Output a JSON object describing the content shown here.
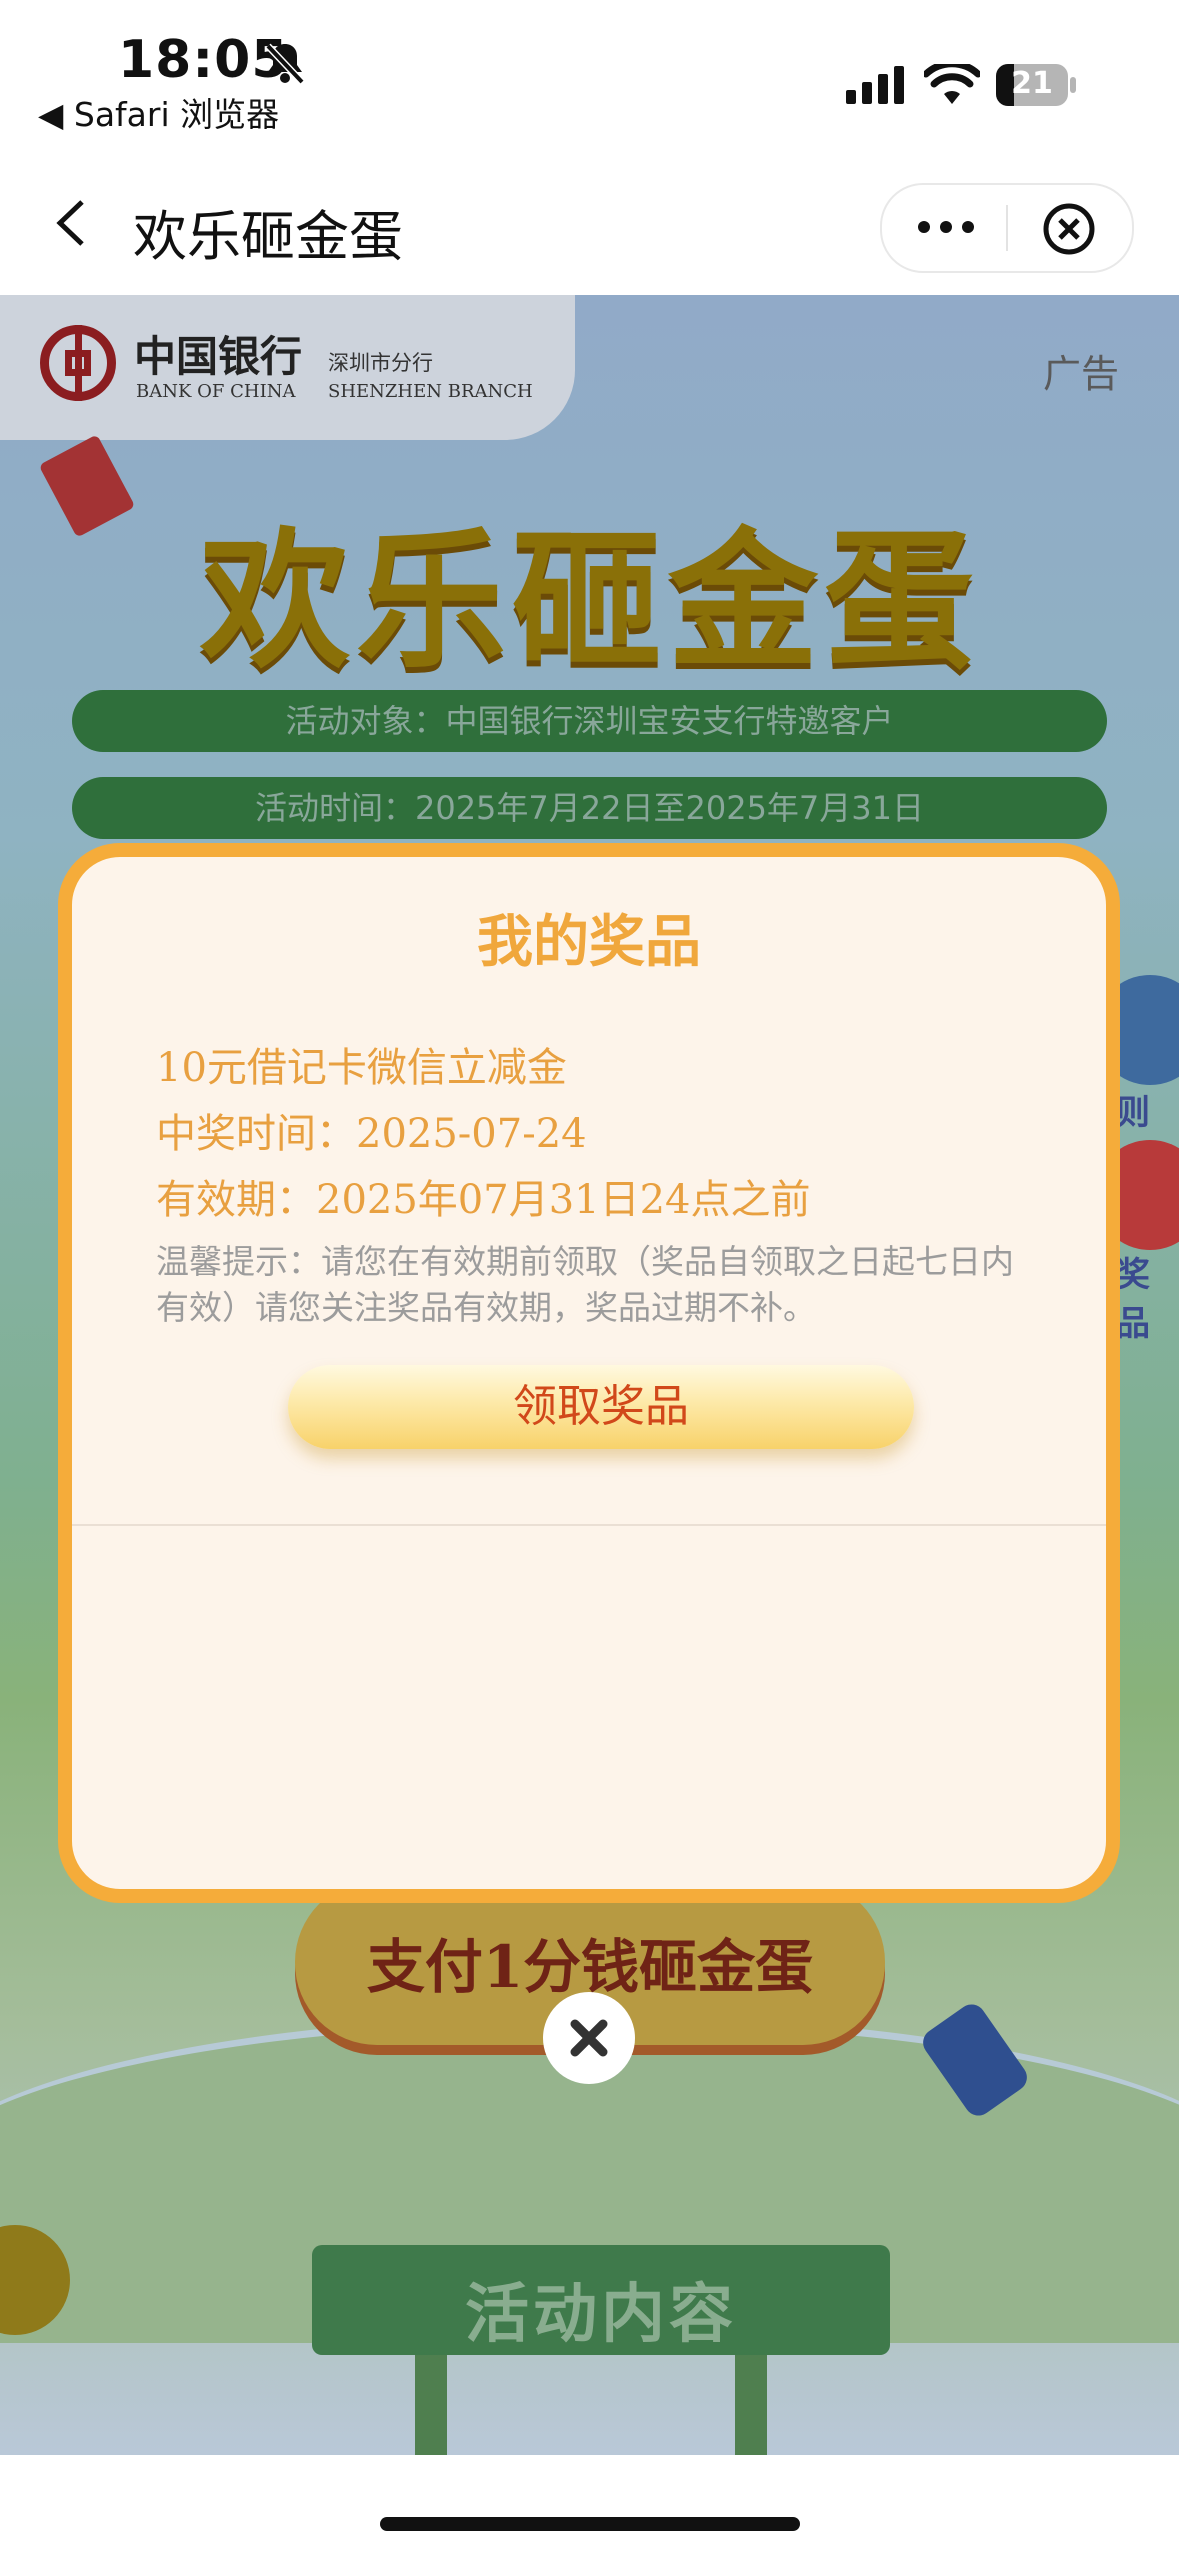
{
  "status_bar": {
    "time": "18:05",
    "back_app": "◀ Safari 浏览器",
    "battery": "21"
  },
  "nav": {
    "title": "欢乐砸金蛋"
  },
  "page": {
    "bank_name_cn": "中国银行",
    "bank_name_en": "BANK OF CHINA",
    "branch_cn": "深圳市分行",
    "branch_en": "SHENZHEN BRANCH",
    "ad_label": "广告",
    "hero_title": "欢乐砸金蛋",
    "target_pill": "活动对象：中国银行深圳宝安支行特邀客户",
    "time_pill": "活动时间：2025年7月22日至2025年7月31日",
    "side_rule_label": "则",
    "side_prize_label": "奖品",
    "pay_button": "支付1分钱砸金蛋",
    "content_title": "活动内容"
  },
  "modal": {
    "title": "我的奖品",
    "prize_name": "10元借记卡微信立减金",
    "win_time": "中奖时间：2025-07-24",
    "valid_until": "有效期：2025年07月31日24点之前",
    "tip": "温馨提示：请您在有效期前领取（奖品自领取之日起七日内有效）请您关注奖品有效期，奖品过期不补。",
    "claim_button": "领取奖品"
  },
  "colors": {
    "modal_border": "#f5ac3a",
    "modal_bg": "#fdf4ea",
    "prize_text": "#e8a040",
    "claim_text": "#d1481a"
  }
}
